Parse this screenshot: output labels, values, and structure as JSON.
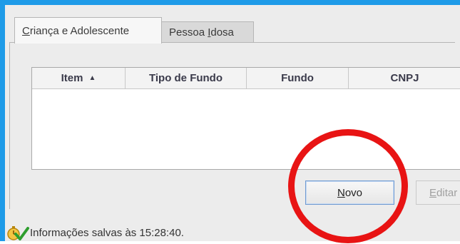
{
  "tabs": [
    {
      "label_u": "C",
      "label_rest": "riança e Adolescente"
    },
    {
      "label_pre": "Pessoa ",
      "label_u": "I",
      "label_rest": "dosa"
    }
  ],
  "table": {
    "headers": [
      "Item",
      "Tipo de Fundo",
      "Fundo",
      "CNPJ"
    ],
    "sort_indicator": "▲",
    "rows": []
  },
  "buttons": {
    "novo": {
      "u": "N",
      "rest": "ovo"
    },
    "editar": {
      "u": "E",
      "rest": "ditar"
    }
  },
  "status": {
    "text": "Informações salvas às 15:28:40."
  },
  "colors": {
    "frame": "#1e9be8",
    "highlight": "#e81414"
  }
}
